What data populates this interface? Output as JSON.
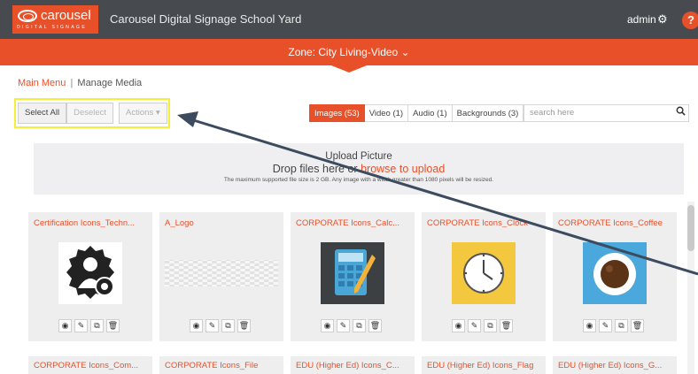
{
  "header": {
    "logo_word": "carousel",
    "logo_sub": "DIGITAL SIGNAGE",
    "app_title": "Carousel Digital Signage School Yard",
    "user": "admin",
    "help_glyph": "?"
  },
  "zone": {
    "label": "Zone: City Living-Video ⌄"
  },
  "breadcrumb": {
    "main": "Main Menu",
    "sep": "|",
    "current": "Manage Media"
  },
  "toolbar": {
    "select_all": "Select All",
    "deselect": "Deselect",
    "actions": "Actions ▾"
  },
  "tabs": [
    {
      "label": "Images (53)",
      "active": true
    },
    {
      "label": "Video (1)"
    },
    {
      "label": "Audio (1)"
    },
    {
      "label": "Backgrounds (3)"
    }
  ],
  "search": {
    "placeholder": "search here"
  },
  "upload": {
    "title": "Upload Picture",
    "drop_prefix": "Drop files here or ",
    "drop_link": "browse to upload",
    "note": "The maximum supported file size is 2 GB. Any image with a width greater than 1080 pixels will be resized."
  },
  "cards_row1": [
    {
      "title": "Certification Icons_Techn...",
      "icon": "certification-gear-icon"
    },
    {
      "title": "A_Logo",
      "icon": "transparent-logo-icon"
    },
    {
      "title": "CORPORATE Icons_Calc...",
      "icon": "calculator-icon"
    },
    {
      "title": "CORPORATE Icons_Clock",
      "icon": "clock-icon"
    },
    {
      "title": "CORPORATE Icons_Coffee",
      "icon": "coffee-icon"
    }
  ],
  "cards_row2": [
    {
      "title": "CORPORATE Icons_Com..."
    },
    {
      "title": "CORPORATE Icons_File"
    },
    {
      "title": "EDU (Higher Ed) Icons_C..."
    },
    {
      "title": "EDU (Higher Ed) Icons_Flag"
    },
    {
      "title": "EDU (Higher Ed) Icons_G..."
    }
  ],
  "card_actions": {
    "view": "◉",
    "edit": "✎",
    "copy": "⧉",
    "delete": "🗑"
  },
  "colors": {
    "accent": "#e8502a",
    "topbar": "#474b50",
    "highlight": "#f4ee3a",
    "arrow": "#3c4b5e"
  }
}
